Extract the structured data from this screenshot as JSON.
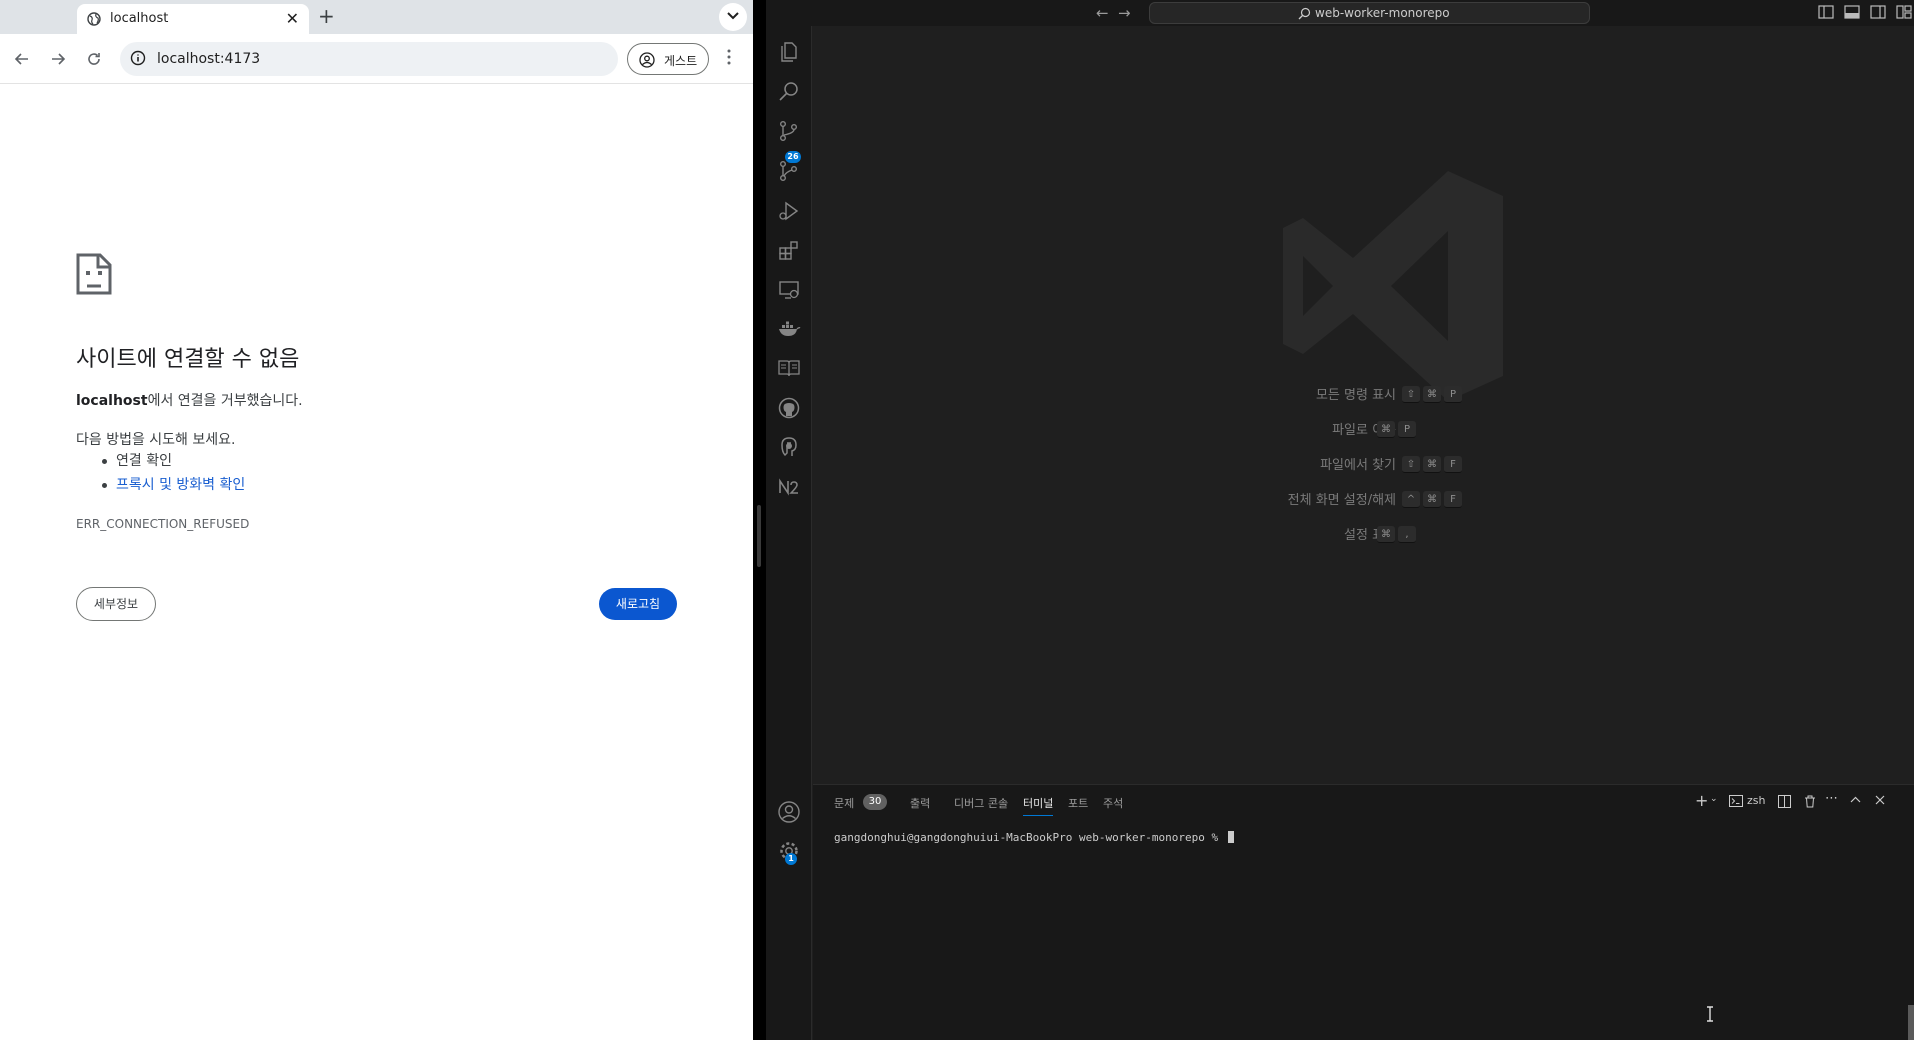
{
  "chrome": {
    "tab_title": "localhost",
    "tab_close": "✕",
    "new_tab": "+",
    "url": "localhost:4173",
    "profile_label": "게스트",
    "error": {
      "title": "사이트에 연결할 수 없음",
      "host": "localhost",
      "desc_suffix": "에서 연결을 거부했습니다.",
      "try_heading": "다음 방법을 시도해 보세요.",
      "suggestions": [
        "연결 확인",
        "프록시 및 방화벽 확인"
      ],
      "code": "ERR_CONNECTION_REFUSED",
      "details_button": "세부정보",
      "reload_button": "새로고침"
    }
  },
  "vscode": {
    "title_search": "web-worker-monorepo",
    "nav_back": "←",
    "nav_forward": "→",
    "activity_badges": {
      "source_control": "26",
      "settings": "1"
    },
    "shortcuts": [
      {
        "label": "모든 명령 표시",
        "keys": [
          "⇧",
          "⌘",
          "P"
        ]
      },
      {
        "label": "파일로 이동",
        "keys": [
          "⌘",
          "P"
        ]
      },
      {
        "label": "파일에서 찾기",
        "keys": [
          "⇧",
          "⌘",
          "F"
        ]
      },
      {
        "label": "전체 화면 설정/해제",
        "keys": [
          "^",
          "⌘",
          "F"
        ]
      },
      {
        "label": "설정 표시",
        "keys": [
          "⌘",
          ","
        ]
      }
    ],
    "panel": {
      "tabs": [
        "문제",
        "출력",
        "디버그 콘솔",
        "터미널",
        "포트",
        "주석"
      ],
      "problems_count": "30",
      "active_tab": "터미널",
      "shell": "zsh",
      "terminal_prompt": "gangdonghui@gangdonghuiui-MacBookPro web-worker-monorepo % "
    }
  },
  "colors": {
    "chrome_accent": "#0b57d0",
    "vscode_accent": "#0078d4",
    "vscode_bg": "#1f1f1f"
  }
}
